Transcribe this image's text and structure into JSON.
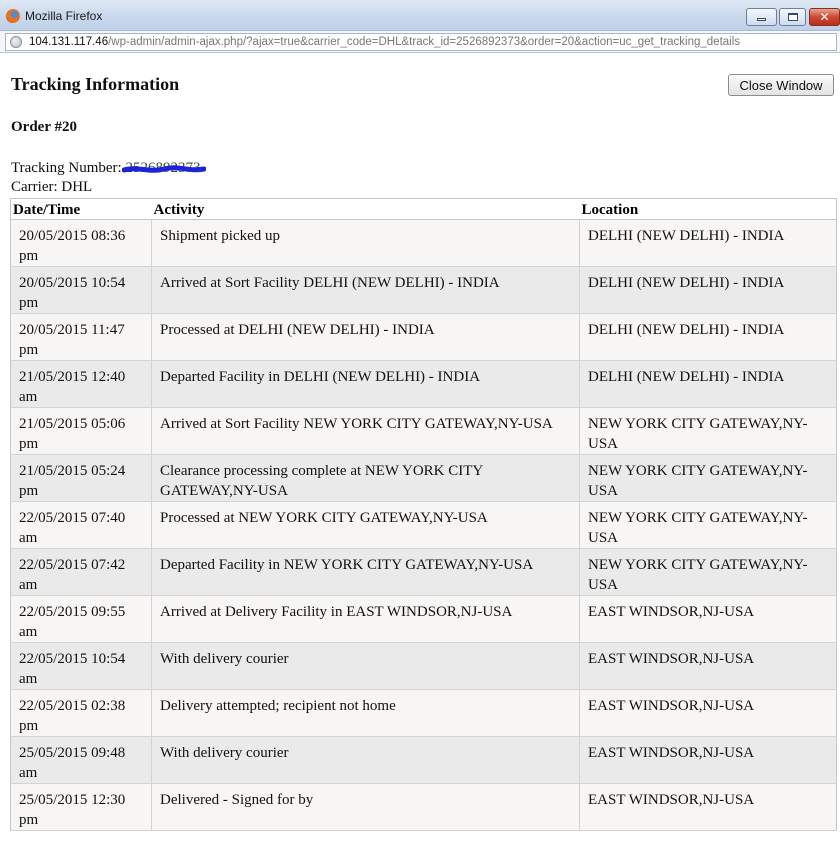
{
  "window": {
    "title": "Mozilla Firefox",
    "icons": {
      "app": "firefox-icon",
      "minimize": "minimize-icon",
      "maximize": "maximize-icon",
      "close": "close-icon"
    },
    "close_glyph": "✕"
  },
  "address_bar": {
    "url_host": "104.131.117.46",
    "url_path": "/wp-admin/admin-ajax.php/?ajax=true&carrier_code=DHL&track_id=2526892373&order=20&action=uc_get_tracking_details",
    "icon": "globe-icon"
  },
  "page": {
    "title": "Tracking Information",
    "close_button_label": "Close Window",
    "order_heading": "Order #20",
    "tracking_label": "Tracking Number:",
    "tracking_number": "2526892373",
    "carrier_label": "Carrier:",
    "carrier_value": "DHL"
  },
  "table": {
    "headers": {
      "datetime": "Date/Time",
      "activity": "Activity",
      "location": "Location"
    },
    "rows": [
      {
        "datetime": "20/05/2015 08:36 pm",
        "activity": "Shipment picked up",
        "location": "DELHI (NEW DELHI) - INDIA"
      },
      {
        "datetime": "20/05/2015 10:54 pm",
        "activity": "Arrived at Sort Facility DELHI (NEW DELHI) - INDIA",
        "location": "DELHI (NEW DELHI) - INDIA"
      },
      {
        "datetime": "20/05/2015 11:47 pm",
        "activity": "Processed at DELHI (NEW DELHI) - INDIA",
        "location": "DELHI (NEW DELHI) - INDIA"
      },
      {
        "datetime": "21/05/2015 12:40 am",
        "activity": "Departed Facility in DELHI (NEW DELHI) - INDIA",
        "location": "DELHI (NEW DELHI) - INDIA"
      },
      {
        "datetime": "21/05/2015 05:06 pm",
        "activity": "Arrived at Sort Facility NEW YORK CITY GATEWAY,NY-USA",
        "location": "NEW YORK CITY GATEWAY,NY-USA"
      },
      {
        "datetime": "21/05/2015 05:24 pm",
        "activity": "Clearance processing complete at NEW YORK CITY GATEWAY,NY-USA",
        "location": "NEW YORK CITY GATEWAY,NY-USA"
      },
      {
        "datetime": "22/05/2015 07:40 am",
        "activity": "Processed at NEW YORK CITY GATEWAY,NY-USA",
        "location": "NEW YORK CITY GATEWAY,NY-USA"
      },
      {
        "datetime": "22/05/2015 07:42 am",
        "activity": "Departed Facility in NEW YORK CITY GATEWAY,NY-USA",
        "location": "NEW YORK CITY GATEWAY,NY-USA"
      },
      {
        "datetime": "22/05/2015 09:55 am",
        "activity": "Arrived at Delivery Facility in EAST WINDSOR,NJ-USA",
        "location": "EAST WINDSOR,NJ-USA"
      },
      {
        "datetime": "22/05/2015 10:54 am",
        "activity": "With delivery courier",
        "location": "EAST WINDSOR,NJ-USA"
      },
      {
        "datetime": "22/05/2015 02:38 pm",
        "activity": "Delivery attempted; recipient not home",
        "location": "EAST WINDSOR,NJ-USA"
      },
      {
        "datetime": "25/05/2015 09:48 am",
        "activity": "With delivery courier",
        "location": "EAST WINDSOR,NJ-USA"
      },
      {
        "datetime": "25/05/2015 12:30 pm",
        "activity": "Delivered - Signed for by",
        "location": "EAST WINDSOR,NJ-USA"
      }
    ]
  }
}
